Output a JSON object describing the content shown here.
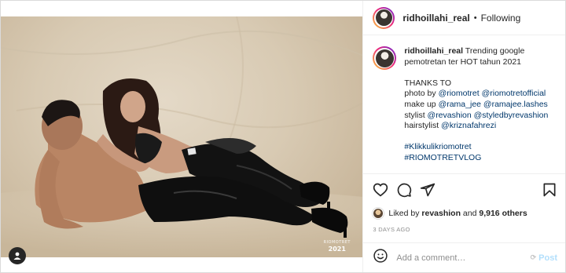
{
  "post": {
    "username": "ridhoillahi_real",
    "follow_status": "Following",
    "header_separator": "•",
    "caption": {
      "username": "ridhoillahi_real",
      "first_line": "Trending google pemotretan ter HOT tahun 2021",
      "thanks": "THANKS TO",
      "photo_prefix": "photo by ",
      "photo_mentions": [
        "@riomotret",
        "@riomotretofficial"
      ],
      "makeup_prefix": "make up ",
      "makeup_mentions": [
        "@rama_jee",
        "@ramajee.lashes"
      ],
      "stylist_prefix": "stylist ",
      "stylist_mentions": [
        "@revashion",
        "@styledbyrevashion"
      ],
      "hairstylist_prefix": "hairstylist ",
      "hairstylist_mentions": [
        "@kriznafahrezi"
      ],
      "hashtags": [
        "#Klikkulikriomotret",
        "#RIOMOTRETVLOG"
      ]
    },
    "likes": {
      "prefix": "Liked by ",
      "user": "revashion",
      "middle": " and ",
      "count": "9,916 others"
    },
    "timestamp": "3 DAYS AGO",
    "comment_placeholder": "Add a comment…",
    "post_button": "Post",
    "watermark": {
      "name": "RIOMOTRET",
      "year": "2021"
    }
  },
  "icons": {
    "like": "heart-icon",
    "comment": "comment-icon",
    "share": "paper-plane-icon",
    "save": "bookmark-icon",
    "emoji": "smiley-icon",
    "tag": "person-tag-icon"
  },
  "colors": {
    "link": "#00376b",
    "muted": "#8e8e8e",
    "post_disabled": "#b2dffc",
    "border": "#dbdbdb"
  }
}
